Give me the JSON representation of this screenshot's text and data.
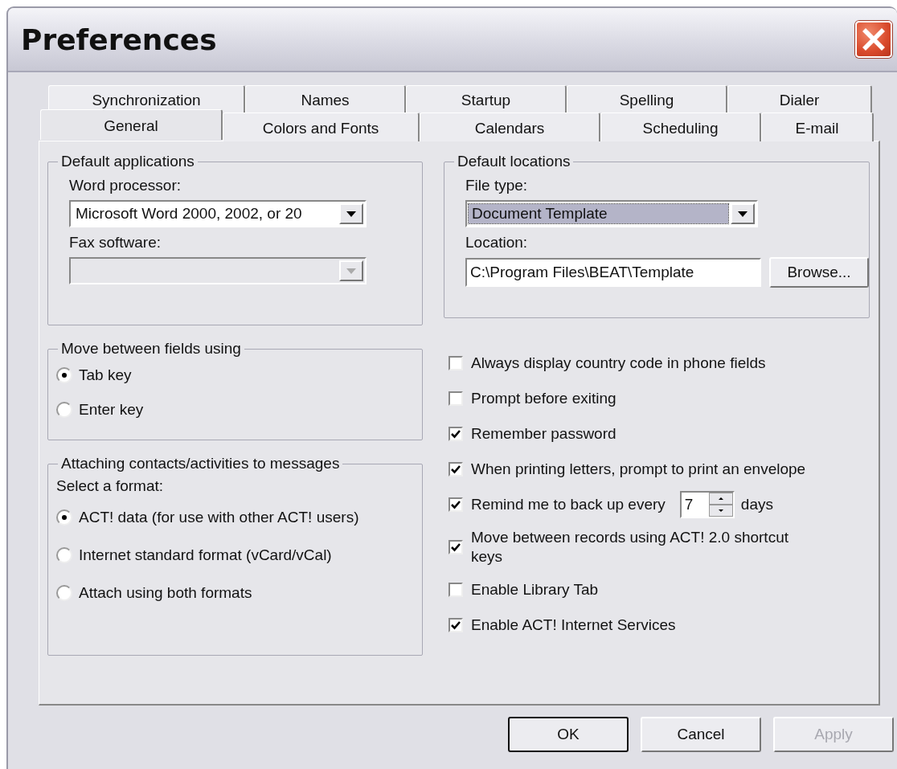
{
  "window": {
    "title": "Preferences"
  },
  "tab_rows": [
    {
      "tabs": [
        {
          "label": "Synchronization",
          "selected": false
        },
        {
          "label": "Names",
          "selected": false
        },
        {
          "label": "Startup",
          "selected": false
        },
        {
          "label": "Spelling",
          "selected": false
        },
        {
          "label": "Dialer",
          "selected": false
        }
      ]
    },
    {
      "tabs": [
        {
          "label": "General",
          "selected": true
        },
        {
          "label": "Colors and Fonts",
          "selected": false
        },
        {
          "label": "Calendars",
          "selected": false
        },
        {
          "label": "Scheduling",
          "selected": false
        },
        {
          "label": "E-mail",
          "selected": false
        }
      ]
    }
  ],
  "default_applications": {
    "title": "Default applications",
    "fields": [
      {
        "label": "Word processor:",
        "value": "Microsoft Word 2000, 2002, or 20",
        "disabled": false
      },
      {
        "label": "Fax software:",
        "disabled": true
      }
    ]
  },
  "move_between_fields": {
    "title": "Move between fields using",
    "options": [
      {
        "label": "Tab key",
        "selected": true
      },
      {
        "label": "Enter key",
        "selected": false
      }
    ]
  },
  "attaching": {
    "title": "Attaching contacts/activities to messages",
    "prompt": "Select a format:",
    "options": [
      {
        "label": "ACT! data (for use with other ACT! users)",
        "selected": true
      },
      {
        "label": "Internet standard format (vCard/vCal)",
        "selected": false
      },
      {
        "label": "Attach using both formats",
        "selected": false
      }
    ]
  },
  "default_locations": {
    "title": "Default locations",
    "file_type": {
      "label": "File type:",
      "value": "Document Template",
      "focused": true
    },
    "location": {
      "label": "Location:",
      "value": "C:\\Program Files\\BEAT\\Template"
    },
    "browse_button": "Browse..."
  },
  "options": [
    {
      "kind": "checkbox",
      "label": "Always display country code in phone fields",
      "checked": false
    },
    {
      "kind": "checkbox",
      "label": "Prompt before exiting",
      "checked": false
    },
    {
      "kind": "checkbox",
      "label": "Remember password",
      "checked": true
    },
    {
      "kind": "checkbox",
      "label": "When printing letters, prompt to print an envelope",
      "checked": true
    },
    {
      "kind": "spinner",
      "label": "Remind me to back up every",
      "checked": true,
      "value": "7",
      "suffix": "days"
    },
    {
      "kind": "checkbox",
      "label": "Move between records using ACT! 2.0 shortcut keys",
      "checked": true
    },
    {
      "kind": "checkbox",
      "label": "Enable Library Tab",
      "checked": false
    },
    {
      "kind": "checkbox",
      "label": "Enable ACT! Internet Services",
      "checked": true
    }
  ],
  "buttons": [
    {
      "label": "OK",
      "default": true,
      "disabled": false
    },
    {
      "label": "Cancel",
      "default": false,
      "disabled": false
    },
    {
      "label": "Apply",
      "default": false,
      "disabled": true
    }
  ]
}
